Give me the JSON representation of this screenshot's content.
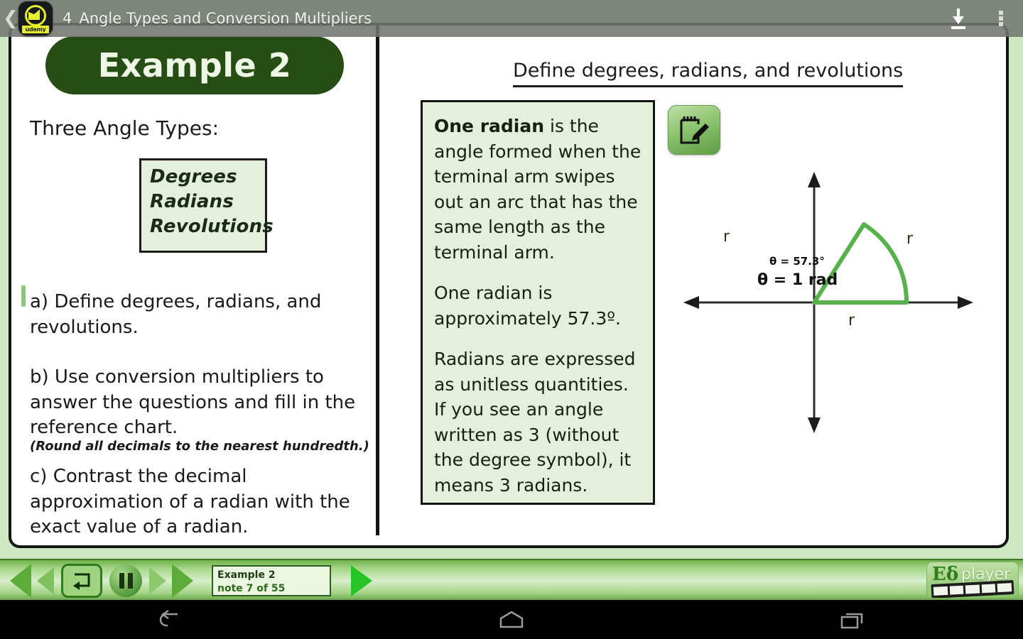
{
  "titlebar": {
    "back_icon": "chevron-left-icon",
    "app_badge": "udemy-logo",
    "app_badge_word": "udemy",
    "lesson_number": "4",
    "title": "Angle Types and Conversion Multipliers",
    "download_icon": "download-icon",
    "overflow_icon": "overflow-menu-icon"
  },
  "left": {
    "example_label": "Example 2",
    "heading": "Three Angle Types:",
    "types": [
      "Degrees",
      "Radians",
      "Revolutions"
    ],
    "item_a": "a) Define degrees, radians, and revolutions.",
    "item_b": "b) Use conversion multipliers to answer the questions and fill in the reference chart.",
    "item_b_note": "(Round all decimals to the nearest hundredth.)",
    "item_c": "c) Contrast the decimal approximation of a radian with the exact value of a radian."
  },
  "right": {
    "title": "Define degrees, radians, and revolutions",
    "note_button_icon": "notepad-pencil-icon",
    "definition": {
      "p1_bold": "One radian",
      "p1_rest": " is the angle formed when the terminal arm swipes out an arc that has the same length as the terminal arm.",
      "p2": "One radian is approximately 57.3º.",
      "p3": "Radians are expressed as unitless quantities. If you see an angle written as 3 (without the degree symbol), it means 3 radians."
    },
    "diagram": {
      "radius_label_left": "r",
      "radius_label_right": "r",
      "radius_label_bottom": "r",
      "theta_degrees": "θ = 57.3°",
      "theta_radians": "θ = 1 rad",
      "arc_color": "#56b24b",
      "axis_color": "#2c2c2c"
    }
  },
  "toolbar": {
    "prev_chapter_icon": "skip-back-icon",
    "prev_icon": "step-back-icon",
    "loop_icon": "repeat-icon",
    "pause_icon": "pause-icon",
    "next_icon": "step-forward-icon",
    "next_chapter_icon": "skip-forward-icon",
    "note_title": "Example 2",
    "note_progress": "note 7 of 55",
    "play_icon": "play-icon",
    "logo_mark": "Εδ",
    "logo_word": "player"
  },
  "navbar": {
    "back_icon": "android-back-icon",
    "home_icon": "android-home-icon",
    "recents_icon": "android-recents-icon"
  },
  "colors": {
    "app_background": "#cfe8c4",
    "pill_green": "#254d14",
    "box_green": "#e4f0dc",
    "accent_green": "#56b24b",
    "titlebar_grey": "#737670"
  }
}
